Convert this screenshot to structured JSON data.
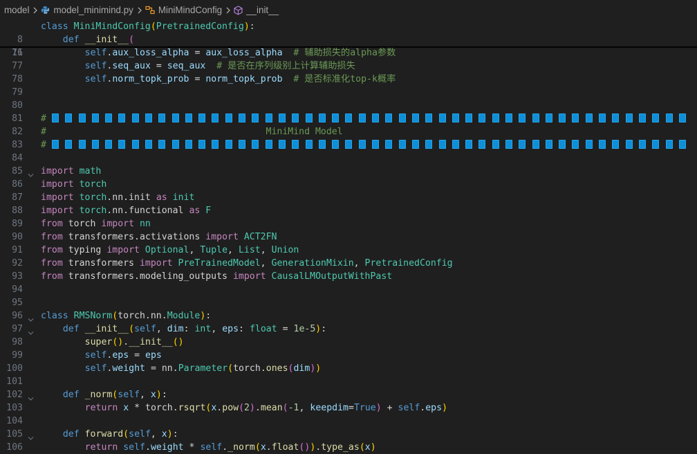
{
  "breadcrumb": {
    "items": [
      {
        "label": "model",
        "icon": "none"
      },
      {
        "label": "model_minimind.py",
        "icon": "python-file-icon"
      },
      {
        "label": "MiniMindConfig",
        "icon": "class-symbol-icon"
      },
      {
        "label": "__init__",
        "icon": "method-symbol-icon"
      }
    ]
  },
  "sticky": [
    {
      "num": "8",
      "code": "class MiniMindConfig(PretrainedConfig):"
    },
    {
      "num": "11",
      "code": "    def __init__("
    }
  ],
  "lines": [
    {
      "num": "76",
      "code": "        self.aux_loss_alpha = aux_loss_alpha  # 辅助损失的alpha参数"
    },
    {
      "num": "77",
      "code": "        self.seq_aux = seq_aux  # 是否在序列级别上计算辅助损失"
    },
    {
      "num": "78",
      "code": "        self.norm_topk_prob = norm_topk_prob  # 是否标准化top-k概率"
    },
    {
      "num": "79",
      "code": ""
    },
    {
      "num": "80",
      "code": ""
    },
    {
      "num": "81",
      "code": "# 📘📘📘📘📘📘📘📘📘📘📘📘📘📘📘📘📘📘📘📘📘📘📘📘📘📘📘📘📘📘📘📘📘📘📘📘📘📘📘📘📘📘📘📘📘📘📘📘"
    },
    {
      "num": "82",
      "code": "#                                        MiniMind Model"
    },
    {
      "num": "83",
      "code": "# 📘📘📘📘📘📘📘📘📘📘📘📘📘📘📘📘📘📘📘📘📘📘📘📘📘📘📘📘📘📘📘📘📘📘📘📘📘📘📘📘📘📘📘📘📘📘📘📘"
    },
    {
      "num": "84",
      "code": ""
    },
    {
      "num": "85",
      "code": "import math"
    },
    {
      "num": "86",
      "code": "import torch"
    },
    {
      "num": "87",
      "code": "import torch.nn.init as init"
    },
    {
      "num": "88",
      "code": "import torch.nn.functional as F"
    },
    {
      "num": "89",
      "code": "from torch import nn"
    },
    {
      "num": "90",
      "code": "from transformers.activations import ACT2FN"
    },
    {
      "num": "91",
      "code": "from typing import Optional, Tuple, List, Union"
    },
    {
      "num": "92",
      "code": "from transformers import PreTrainedModel, GenerationMixin, PretrainedConfig"
    },
    {
      "num": "93",
      "code": "from transformers.modeling_outputs import CausalLMOutputWithPast"
    },
    {
      "num": "94",
      "code": ""
    },
    {
      "num": "95",
      "code": ""
    },
    {
      "num": "96",
      "code": "class RMSNorm(torch.nn.Module):"
    },
    {
      "num": "97",
      "code": "    def __init__(self, dim: int, eps: float = 1e-5):"
    },
    {
      "num": "98",
      "code": "        super().__init__()"
    },
    {
      "num": "99",
      "code": "        self.eps = eps"
    },
    {
      "num": "100",
      "code": "        self.weight = nn.Parameter(torch.ones(dim))"
    },
    {
      "num": "101",
      "code": ""
    },
    {
      "num": "102",
      "code": "    def _norm(self, x):"
    },
    {
      "num": "103",
      "code": "        return x * torch.rsqrt(x.pow(2).mean(-1, keepdim=True) + self.eps)"
    },
    {
      "num": "104",
      "code": ""
    },
    {
      "num": "105",
      "code": "    def forward(self, x):"
    },
    {
      "num": "106",
      "code": "        return self.weight * self._norm(x.float()).type_as(x)"
    }
  ]
}
